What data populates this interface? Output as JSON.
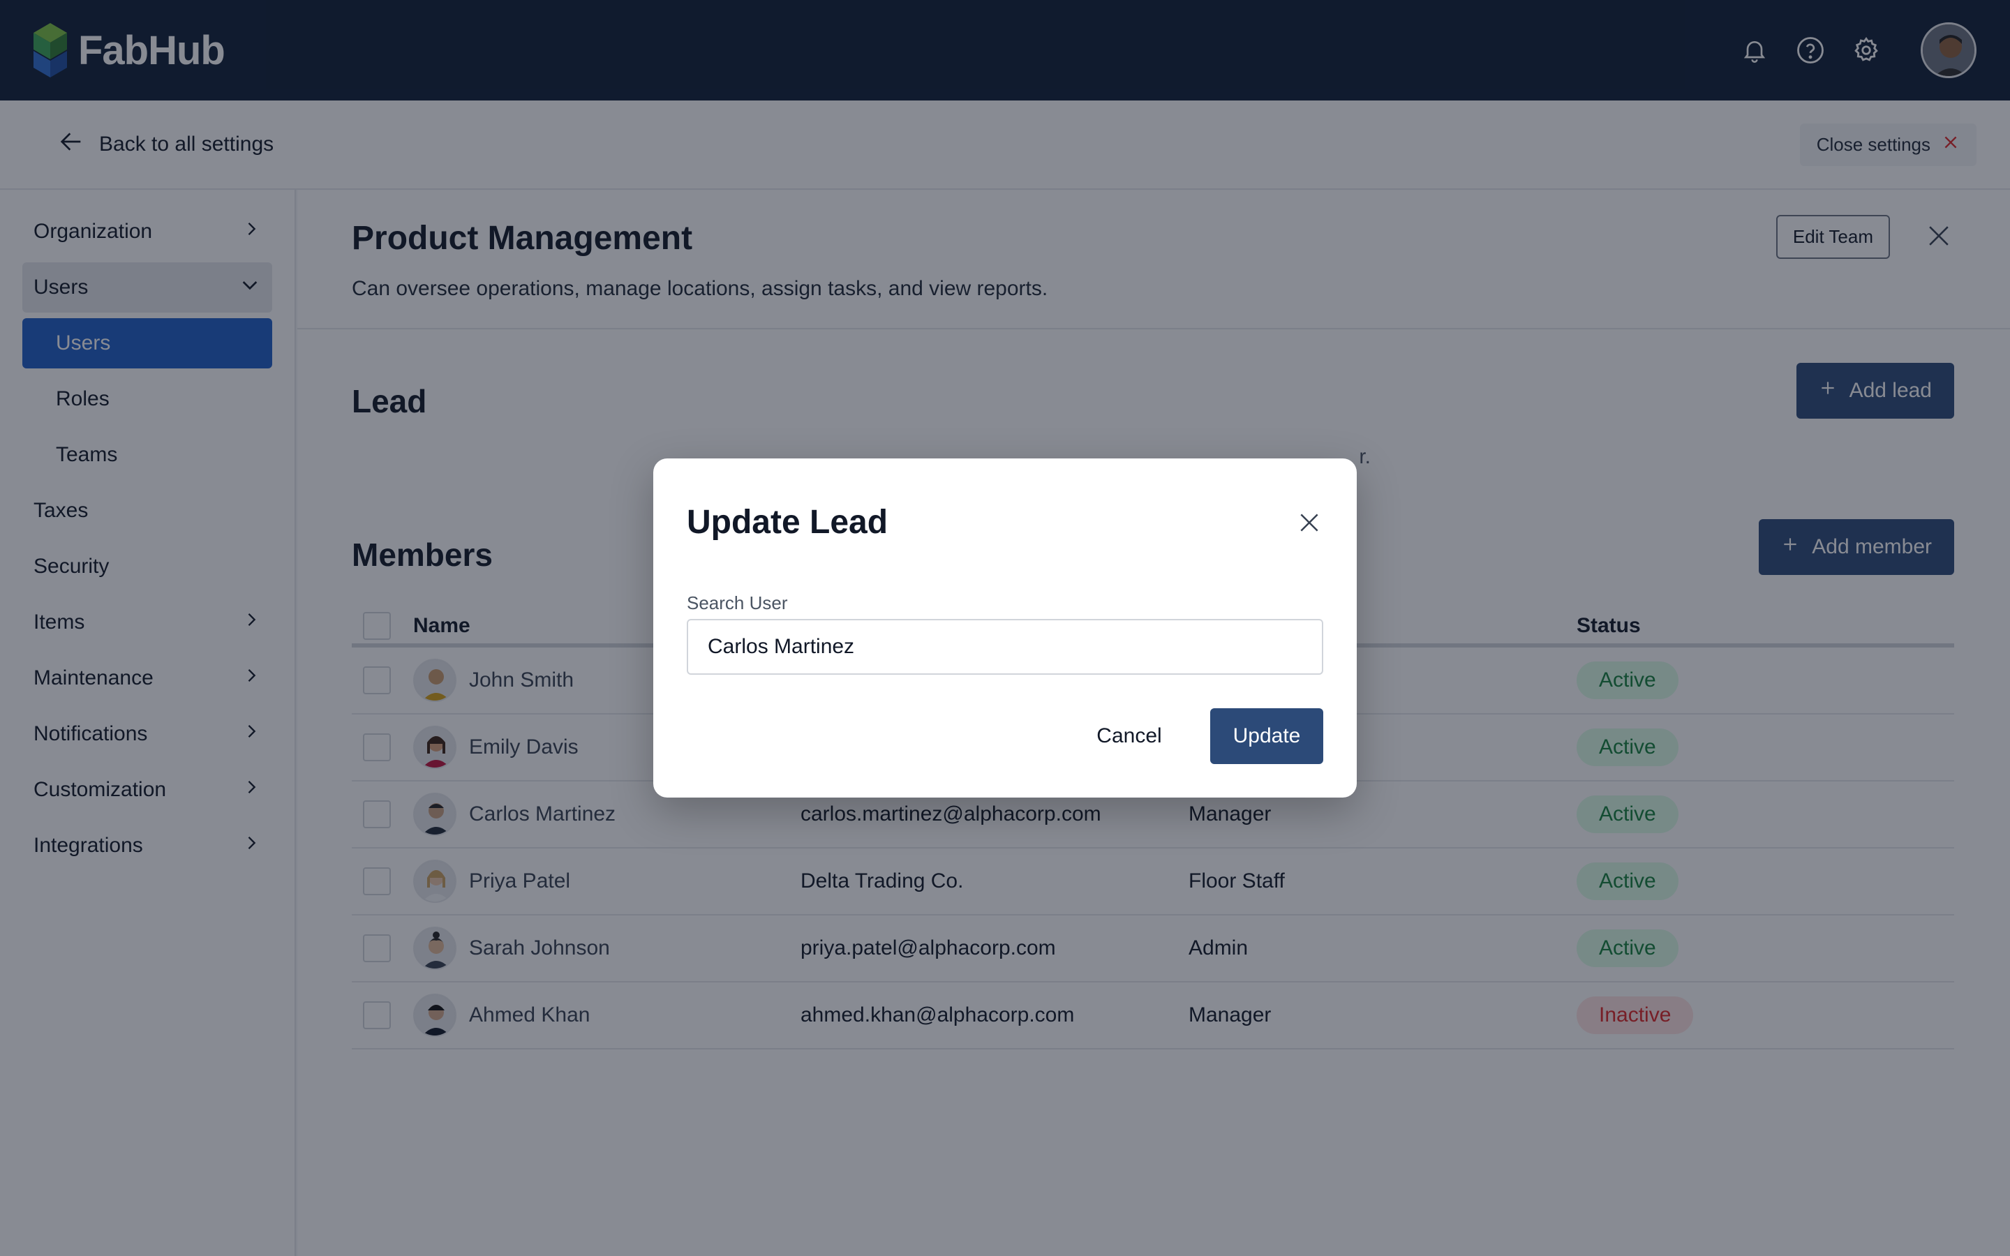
{
  "app": {
    "name": "FabHub"
  },
  "topbar": {
    "icons": [
      "bell-icon",
      "help-icon",
      "gear-icon"
    ],
    "avatar_label": "user-avatar"
  },
  "settings_header": {
    "back_label": "Back to all settings",
    "close_label": "Close settings"
  },
  "sidebar": {
    "items": [
      {
        "label": "Organization",
        "chevron": "right"
      },
      {
        "label": "Users",
        "chevron": "down",
        "expanded": true
      },
      {
        "label": "Users",
        "sub": true,
        "active": true
      },
      {
        "label": "Roles",
        "sub": true
      },
      {
        "label": "Teams",
        "sub": true
      },
      {
        "label": "Taxes"
      },
      {
        "label": "Security"
      },
      {
        "label": "Items",
        "chevron": "right"
      },
      {
        "label": "Maintenance",
        "chevron": "right"
      },
      {
        "label": "Notifications",
        "chevron": "right"
      },
      {
        "label": "Customization",
        "chevron": "right"
      },
      {
        "label": "Integrations",
        "chevron": "right"
      }
    ]
  },
  "team": {
    "title": "Product Management",
    "description": "Can oversee operations, manage locations, assign tasks, and view reports.",
    "edit_label": "Edit Team"
  },
  "lead": {
    "title": "Lead",
    "add_label": "Add lead",
    "empty_text_tail": "r."
  },
  "members": {
    "title": "Members",
    "add_label": "Add member",
    "columns": {
      "name": "Name",
      "status": "Status"
    },
    "rows": [
      {
        "name": "John Smith",
        "email": "",
        "role": "",
        "status": "Active"
      },
      {
        "name": "Emily Davis",
        "email": "",
        "role": "",
        "status": "Active"
      },
      {
        "name": "Carlos Martinez",
        "email": "carlos.martinez@alphacorp.com",
        "role": "Manager",
        "status": "Active"
      },
      {
        "name": "Priya Patel",
        "email": "Delta Trading Co.",
        "role": "Floor Staff",
        "status": "Active"
      },
      {
        "name": "Sarah Johnson",
        "email": "priya.patel@alphacorp.com",
        "role": "Admin",
        "status": "Active"
      },
      {
        "name": "Ahmed Khan",
        "email": "ahmed.khan@alphacorp.com",
        "role": "Manager",
        "status": "Inactive"
      }
    ]
  },
  "modal": {
    "title": "Update Lead",
    "field_label": "Search User",
    "field_value": "Carlos Martinez",
    "cancel_label": "Cancel",
    "update_label": "Update"
  },
  "colors": {
    "topbar": "#0f1e36",
    "primary": "#2c4a78",
    "nav_active": "#1f5fc7",
    "status_active": "#15803d",
    "status_inactive": "#dc2626"
  }
}
